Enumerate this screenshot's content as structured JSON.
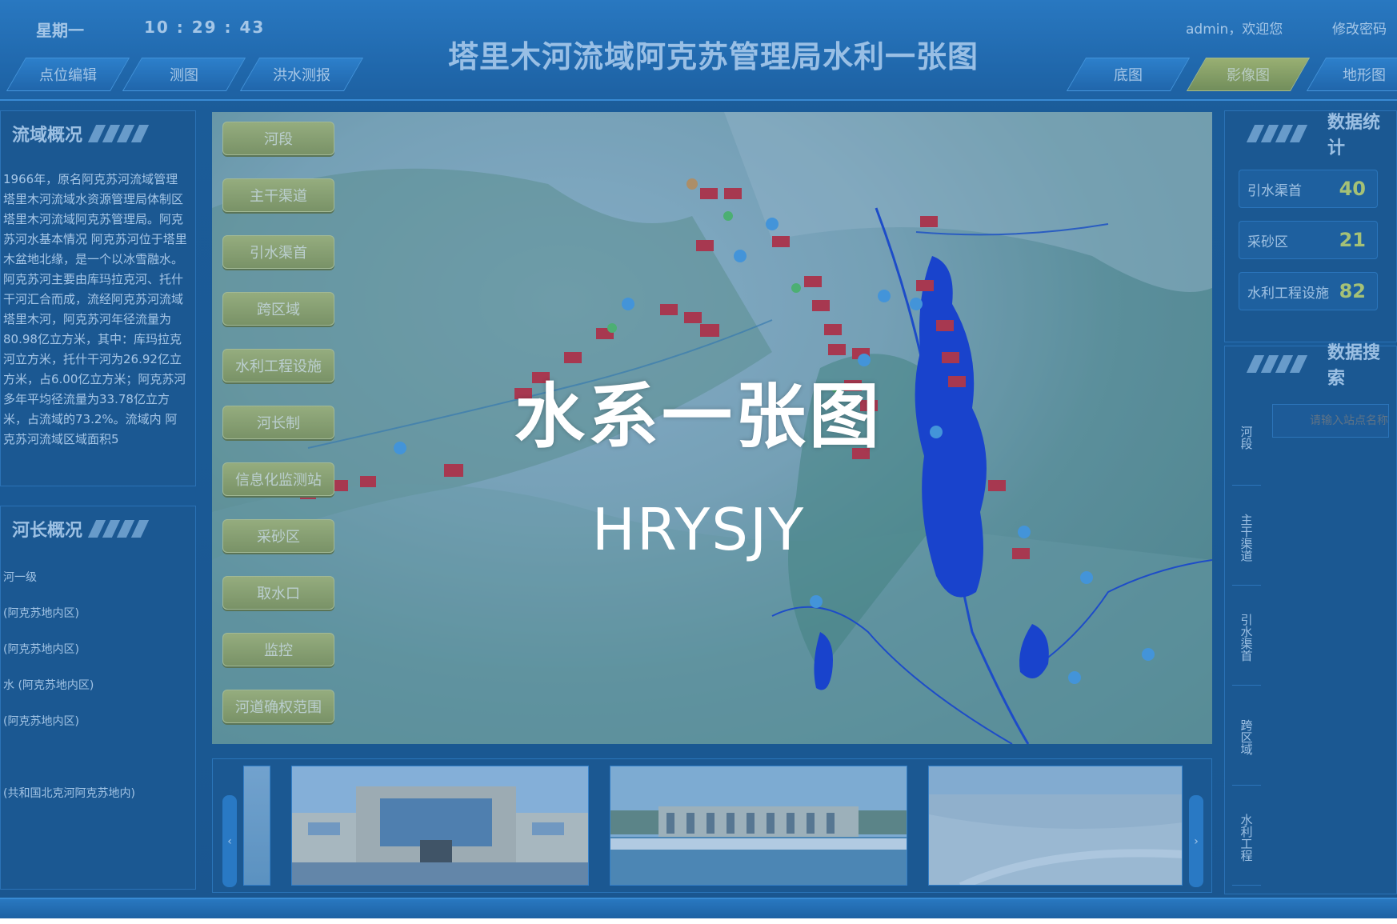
{
  "header": {
    "day": "星期一",
    "time": "10 : 29 : 43",
    "title": "塔里木河流域阿克苏管理局水利一张图",
    "user": "admin，欢迎您",
    "change_password": "修改密码",
    "left_tabs": [
      "点位编辑",
      "测图",
      "洪水测报"
    ],
    "right_tabs": [
      "底图",
      "影像图",
      "地形图"
    ],
    "active_tab": "影像图"
  },
  "left_panel": {
    "basin_title": "流域概况",
    "basin_text": "1966年，原名阿克苏河流域管理塔里木河流域水资源管理局体制区塔里木河流域阿克苏管理局。阿克苏河水基本情况 阿克苏河位于塔里木盆地北缘，是一个以冰雪融水。阿克苏河主要由库玛拉克河、托什干河汇合而成，流经阿克苏河流域塔里木河，阿克苏河年径流量为80.98亿立方米，其中：库玛拉克河立方米，托什干河为26.92亿立方米，占6.00亿立方米；阿克苏河多年平均径流量为33.78亿立方米，占流域的73.2%。流域内 阿克苏河流域区域面积5",
    "river_title": "河长概况",
    "river_items": [
      "河一级",
      "(阿克苏地内区)",
      "(阿克苏地内区)",
      "水 (阿克苏地内区)",
      "(阿克苏地内区)",
      "",
      "(共和国北克河阿克苏地内)"
    ]
  },
  "map_layers": [
    "河段",
    "主干渠道",
    "引水渠首",
    "跨区域",
    "水利工程设施",
    "河长制",
    "信息化监测站",
    "采砂区",
    "取水口",
    "监控",
    "河道确权范围"
  ],
  "overlay": {
    "title": "水系一张图",
    "subtitle": "HRYSJY"
  },
  "right_panel": {
    "data_title": "数据统计",
    "stats": [
      {
        "label": "引水渠首",
        "value": "40"
      },
      {
        "label": "采砂区",
        "value": "21"
      },
      {
        "label": "水利工程设施",
        "value": "82"
      }
    ],
    "search_title": "数据搜索",
    "search_placeholder": "请输入站点名称",
    "vertical_tabs": [
      "河段",
      "主干渠道",
      "引水渠首",
      "跨区域",
      "水利工程"
    ]
  },
  "carousel": {
    "prev": "‹",
    "next": "›"
  },
  "colors": {
    "accent": "#1f68ad",
    "active_tab": "#b8bd58",
    "stat_value": "#d6e15f",
    "marker_red": "#d8232a",
    "water_blue": "#1433d6"
  }
}
